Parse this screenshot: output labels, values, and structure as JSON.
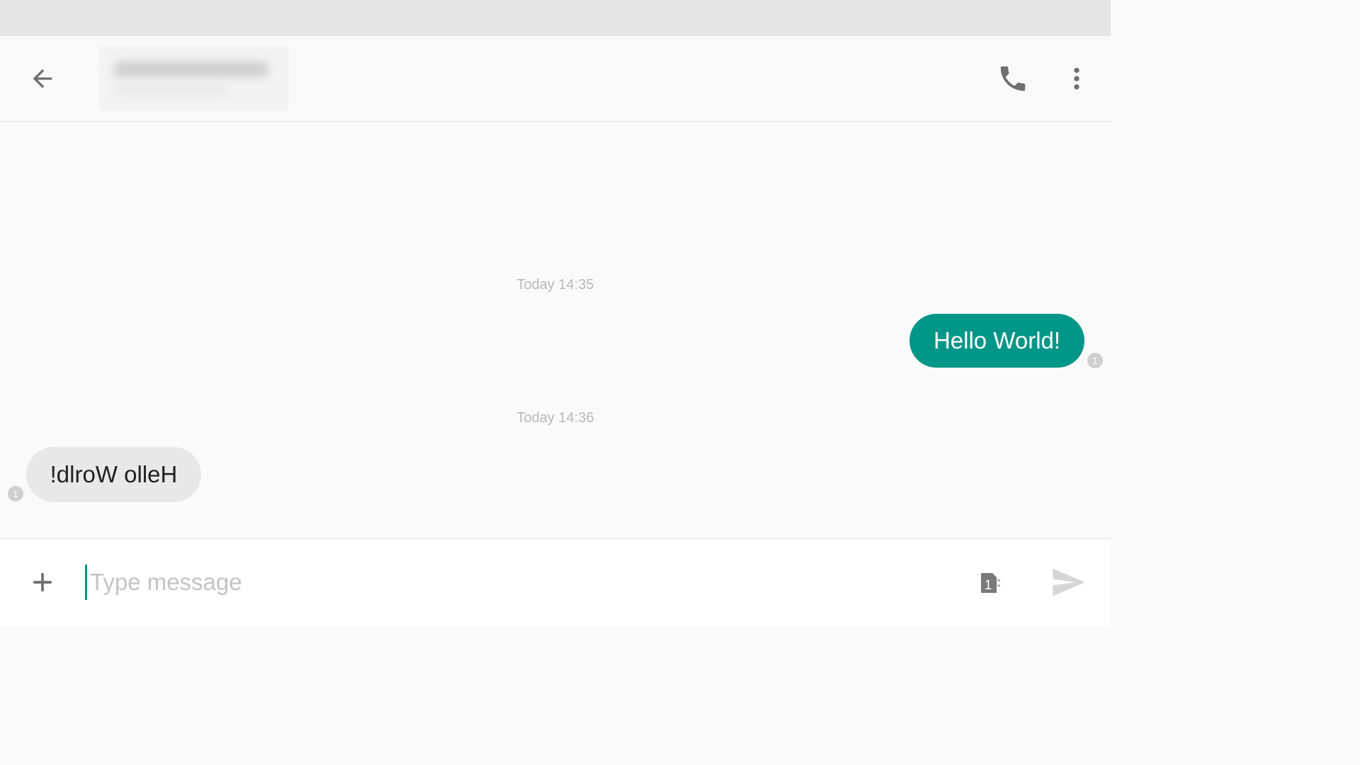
{
  "header": {
    "contact_name": "",
    "icons": {
      "back": "arrow-left-icon",
      "call": "phone-icon",
      "more": "more-vertical-icon"
    }
  },
  "conversation": {
    "messages": [
      {
        "timestamp": "Today 14:35",
        "direction": "outgoing",
        "text": "Hello World!",
        "sim": "1"
      },
      {
        "timestamp": "Today 14:36",
        "direction": "incoming",
        "text": "!dlroW olleH",
        "sim": "1"
      }
    ]
  },
  "compose": {
    "placeholder": "Type message",
    "value": "",
    "sim_slot": "1",
    "icons": {
      "attach": "plus-icon",
      "sim": "sim-card-icon",
      "send": "send-icon"
    }
  },
  "colors": {
    "accent": "#009688",
    "status_bar": "#e6e6e6",
    "incoming_bubble": "#e8e8e8",
    "timestamp": "#b8b8b8"
  }
}
